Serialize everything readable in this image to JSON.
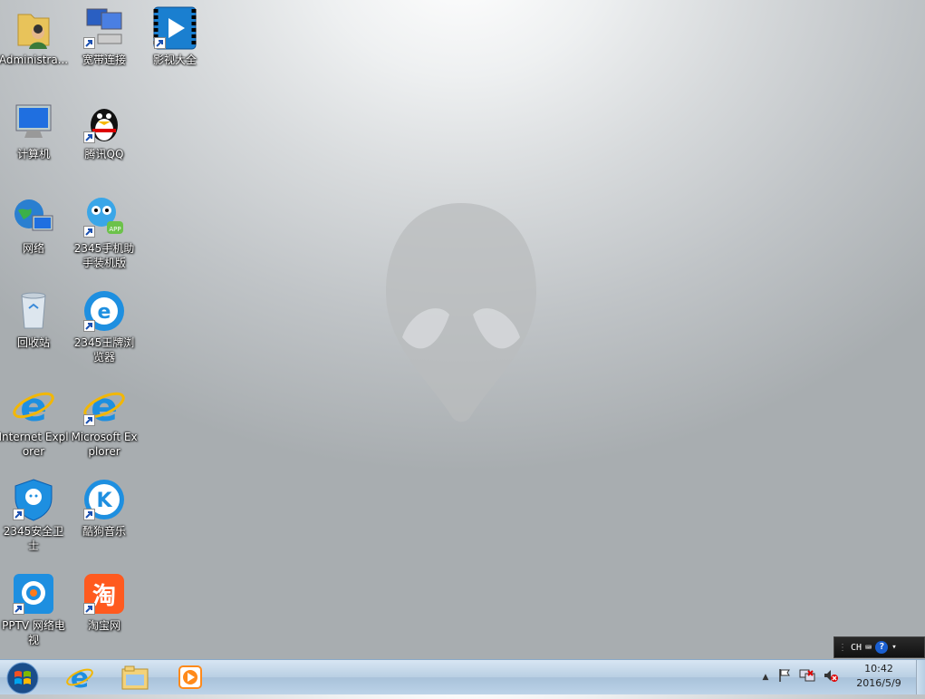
{
  "desktop": {
    "icons": [
      {
        "label": "Administra...",
        "name": "administrator-folder-icon"
      },
      {
        "label": "宽带连接",
        "name": "broadband-connection-icon"
      },
      {
        "label": "影视大全",
        "name": "video-app-icon"
      },
      {
        "label": "计算机",
        "name": "computer-icon"
      },
      {
        "label": "腾讯QQ",
        "name": "qq-icon"
      },
      {
        "label": "网络",
        "name": "network-icon"
      },
      {
        "label": "2345手机助手装机版",
        "name": "phone-assistant-icon"
      },
      {
        "label": "回收站",
        "name": "recycle-bin-icon"
      },
      {
        "label": "2345王牌浏览器",
        "name": "browser-2345-icon"
      },
      {
        "label": "Internet Explorer",
        "name": "internet-explorer-icon"
      },
      {
        "label": "Microsoft Explorer",
        "name": "microsoft-explorer-icon"
      },
      {
        "label": "2345安全卫士",
        "name": "security-guard-icon"
      },
      {
        "label": "酷狗音乐",
        "name": "kugou-music-icon"
      },
      {
        "label": "PPTV 网络电视",
        "name": "pptv-icon"
      },
      {
        "label": "淘宝网",
        "name": "taobao-icon"
      }
    ]
  },
  "langbar": {
    "lang": "CH"
  },
  "taskbar": {
    "pinned": [
      "internet-explorer",
      "windows-explorer",
      "media-player"
    ],
    "time": "10:42",
    "date": "2016/5/9"
  },
  "colors": {
    "taskbar": "#b9cfe3",
    "desktop": "#c0c4c7"
  }
}
